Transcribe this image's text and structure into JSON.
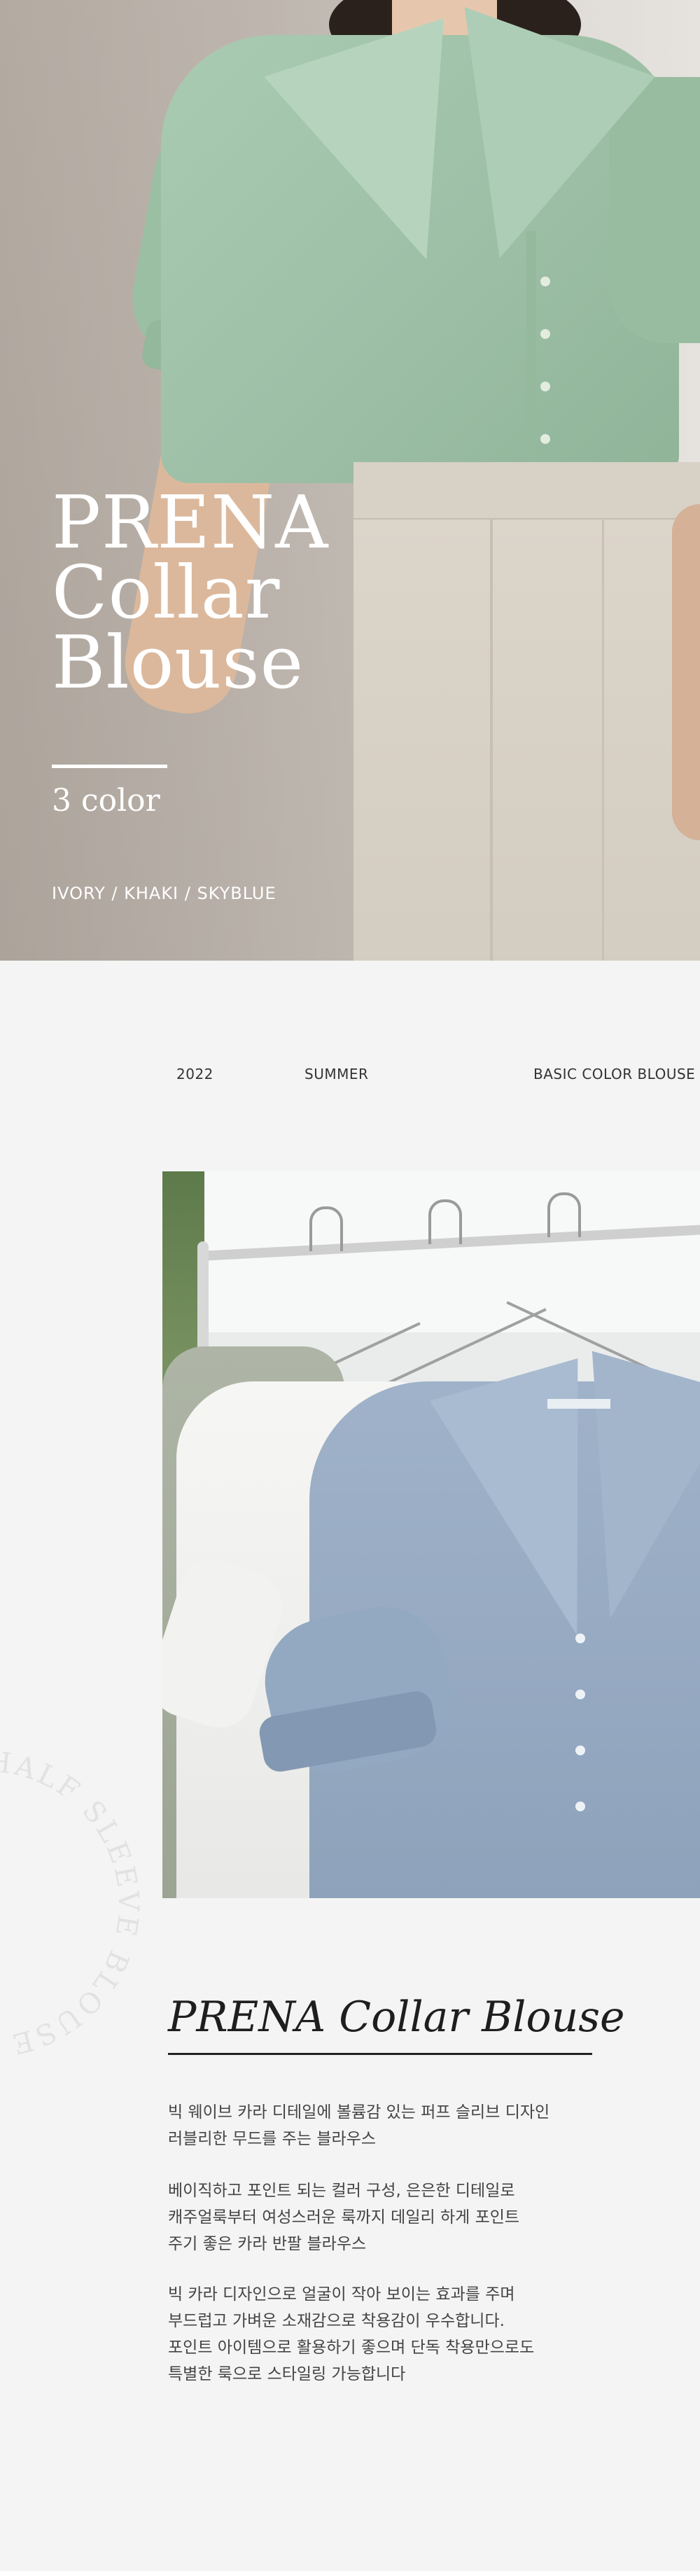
{
  "hero": {
    "title_lines": [
      "PRENA",
      "Collar",
      "Blouse"
    ],
    "color_count": "3 color",
    "color_list": "IVORY / KHAKI / SKYBLUE"
  },
  "info": {
    "year": "2022",
    "season": "SUMMER",
    "category": "BASIC COLOR BLOUSE"
  },
  "curved_text": "HALF SLEEVE BLOUSE",
  "product": {
    "title": "PRENA Collar Blouse",
    "paragraphs": [
      [
        "빅 웨이브 카라 디테일에 볼륨감 있는 퍼프 슬리브 디자인",
        "러블리한 무드를 주는 블라우스"
      ],
      [
        "베이직하고 포인트 되는 컬러 구성, 은은한 디테일로",
        "캐주얼룩부터 여성스러운 룩까지 데일리 하게 포인트",
        "주기 좋은 카라 반팔 블라우스"
      ],
      [
        "빅 카라 디자인으로 얼굴이 작아 보이는 효과를 주며",
        "부드럽고 가벼운 소재감으로 착용감이 우수합니다.",
        "포인트 아이템으로 활용하기 좋으며 단독 착용만으로도",
        "특별한 룩으로 스타일링 가능합니다"
      ]
    ]
  }
}
